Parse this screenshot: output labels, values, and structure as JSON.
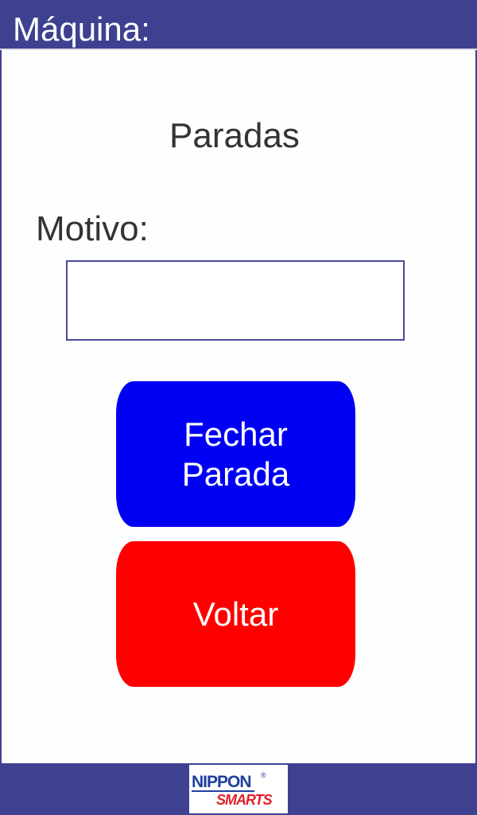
{
  "header": {
    "title": "Máquina:"
  },
  "main": {
    "page_title": "Paradas",
    "motivo_label": "Motivo:",
    "motivo_value": "",
    "fechar_label": "Fechar Parada",
    "voltar_label": "Voltar"
  },
  "footer": {
    "logo_text_top": "NIPPON",
    "logo_text_bottom": "SMARTS",
    "logo_mark": "®"
  },
  "colors": {
    "header_bg": "#3e4190",
    "fechar_bg": "#0000f4",
    "voltar_bg": "#ff0000",
    "logo_blue": "#1f3f9e",
    "logo_red": "#e0202a"
  }
}
